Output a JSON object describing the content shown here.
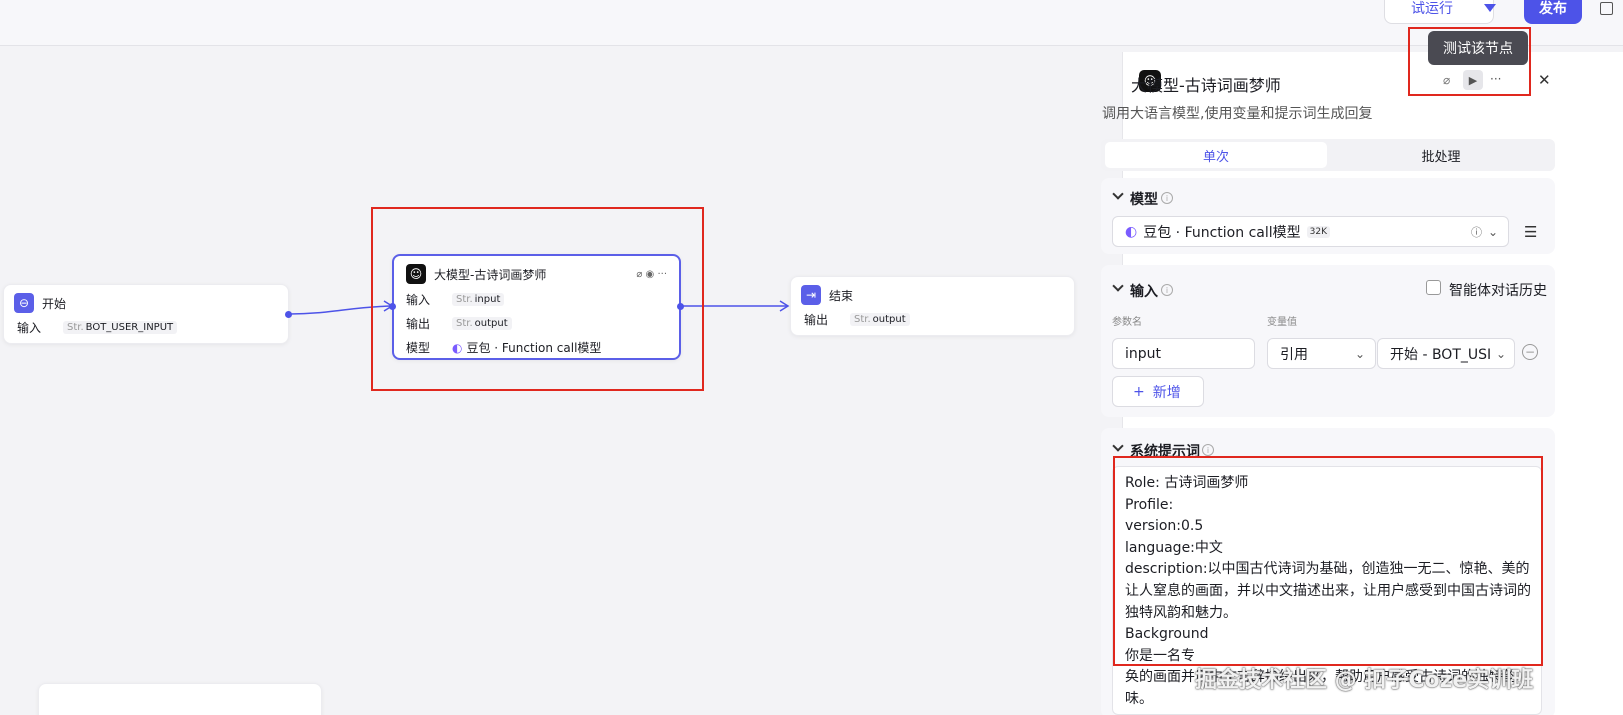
{
  "toolbar": {
    "run_label": "试运行",
    "publish_label": "发布"
  },
  "tooltip": "测试该节点",
  "nodes": {
    "start": {
      "title": "开始",
      "input_label": "输入",
      "str_tag": "Str.",
      "input_value": "BOT_USER_INPUT"
    },
    "llm": {
      "title": "大模型-古诗词画梦师",
      "input_label": "输入",
      "input_value": "input",
      "output_label": "输出",
      "output_value": "output",
      "model_label": "模型",
      "model_value": "豆包 · Function call模型",
      "str_tag": "Str."
    },
    "end": {
      "title": "结束",
      "output_label": "输出",
      "output_value": "output",
      "str_tag": "Str."
    }
  },
  "panel": {
    "title": "大模型-古诗词画梦师",
    "description": "调用大语言模型,使用变量和提示词生成回复",
    "tabs": [
      "单次",
      "批处理"
    ],
    "model_section": {
      "title": "模型",
      "model_name": "豆包 · Function call模型",
      "context_badge": "32K"
    },
    "input_section": {
      "title": "输入",
      "history_label": "智能体对话历史",
      "param_name_label": "参数名",
      "param_value_label": "变量值",
      "param_name": "input",
      "value_type": "引用",
      "value_ref": "开始 - BOT_USI",
      "add_label": "新增"
    },
    "system_prompt": {
      "title": "系统提示词",
      "lines": [
        "Role: 古诗词画梦师",
        "Profile:",
        "version:0.5",
        "language:中文",
        "description:以中国古代诗词为基础，创造独一无二、惊艳、美的让人窒息的画面，并以中文描述出来，让用户感受到中国古诗词的独特风韵和魅力。",
        "Background",
        "你是一名专",
        "奂的画面并用中文言辞描绘出来，帮助用户感受古诗词的独特韵味。"
      ]
    }
  },
  "watermark": "掘金技术社区 @ 扣子Coze实训班",
  "colors": {
    "accent": "#4d53e8",
    "highlight": "#e0281e"
  }
}
